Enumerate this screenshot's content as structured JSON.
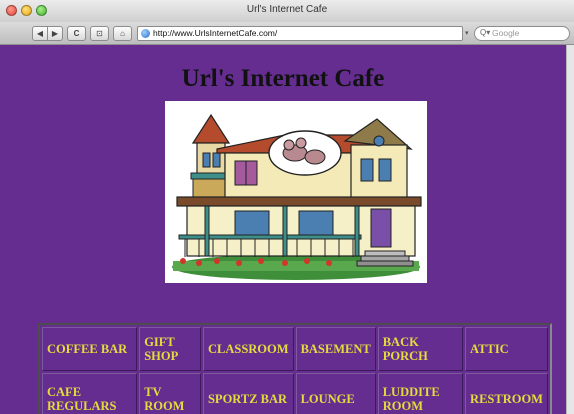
{
  "window": {
    "title": "Url's Internet Cafe"
  },
  "toolbar": {
    "back_icon": "◀",
    "forward_icon": "▶",
    "reload_icon": "C",
    "snapback_icon": "⊡",
    "home_icon": "⌂",
    "url": "http://www.UrlsInternetCafe.com/",
    "search_placeholder": "Google",
    "search_icon": "Q▾"
  },
  "page": {
    "heading": "Url's Internet Cafe",
    "image": "victorian-house-with-mouse-illustration"
  },
  "nav": {
    "rows": [
      [
        "COFFEE BAR",
        "GIFT SHOP",
        "CLASSROOM",
        "BASEMENT",
        "BACK PORCH",
        "ATTIC"
      ],
      [
        "CAFE REGULARS",
        "TV ROOM",
        "SPORTZ BAR",
        "LOUNGE",
        "LUDDITE ROOM",
        "RESTROOM"
      ]
    ]
  },
  "colors": {
    "page_background": "#662d91",
    "nav_text": "#e2dc3c",
    "heading_text": "#111111"
  }
}
